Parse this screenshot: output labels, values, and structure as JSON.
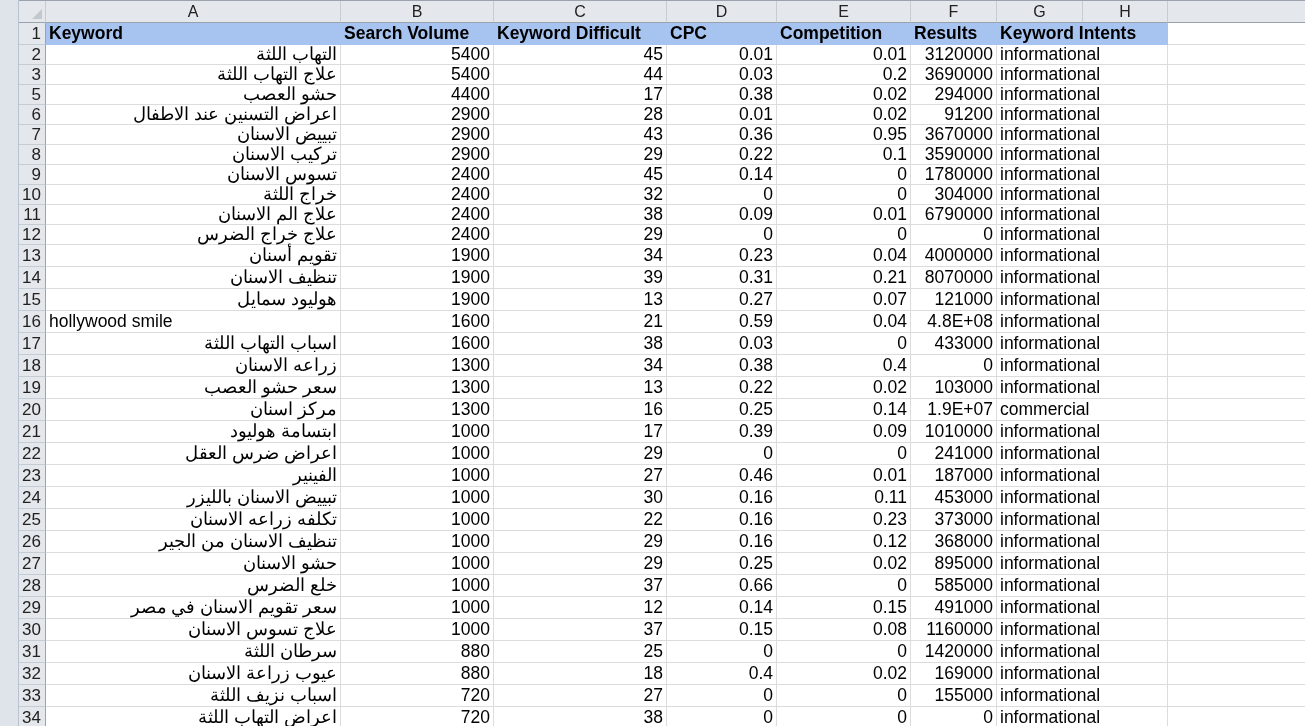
{
  "columns": [
    "A",
    "B",
    "C",
    "D",
    "E",
    "F",
    "G",
    "H"
  ],
  "header": {
    "number": "1",
    "cells": [
      "Keyword",
      "Search Volume",
      "Keyword Difficult",
      "CPC",
      "Competition",
      "Results",
      "Keyword Intents"
    ]
  },
  "rows": [
    {
      "number": "2",
      "cells": [
        "التهاب اللثة",
        "5400",
        "45",
        "0.01",
        "0.01",
        "3120000",
        "informational"
      ]
    },
    {
      "number": "3",
      "cells": [
        "علاج التهاب اللثة",
        "5400",
        "44",
        "0.03",
        "0.2",
        "3690000",
        "informational"
      ]
    },
    {
      "number": "5",
      "cells": [
        "حشو العصب",
        "4400",
        "17",
        "0.38",
        "0.02",
        "294000",
        "informational"
      ]
    },
    {
      "number": "6",
      "cells": [
        "اعراض التسنين عند الاطفال",
        "2900",
        "28",
        "0.01",
        "0.02",
        "91200",
        "informational"
      ]
    },
    {
      "number": "7",
      "cells": [
        "تبييض الاسنان",
        "2900",
        "43",
        "0.36",
        "0.95",
        "3670000",
        "informational"
      ]
    },
    {
      "number": "8",
      "cells": [
        "تركيب الاسنان",
        "2900",
        "29",
        "0.22",
        "0.1",
        "3590000",
        "informational"
      ]
    },
    {
      "number": "9",
      "cells": [
        "تسوس الاسنان",
        "2400",
        "45",
        "0.14",
        "0",
        "1780000",
        "informational"
      ]
    },
    {
      "number": "10",
      "cells": [
        "خراج اللثة",
        "2400",
        "32",
        "0",
        "0",
        "304000",
        "informational"
      ]
    },
    {
      "number": "11",
      "cells": [
        "علاج الم الاسنان",
        "2400",
        "38",
        "0.09",
        "0.01",
        "6790000",
        "informational"
      ]
    },
    {
      "number": "12",
      "cells": [
        "علاج خراج الضرس",
        "2400",
        "29",
        "0",
        "0",
        "0",
        "informational"
      ]
    },
    {
      "number": "13",
      "cells": [
        "تقويم أسنان",
        "1900",
        "34",
        "0.23",
        "0.04",
        "4000000",
        "informational"
      ]
    },
    {
      "number": "14",
      "cells": [
        "تنظيف الاسنان",
        "1900",
        "39",
        "0.31",
        "0.21",
        "8070000",
        "informational"
      ]
    },
    {
      "number": "15",
      "cells": [
        "هوليود سمايل",
        "1900",
        "13",
        "0.27",
        "0.07",
        "121000",
        "informational"
      ]
    },
    {
      "number": "16",
      "cells": [
        "hollywood smile",
        "1600",
        "21",
        "0.59",
        "0.04",
        "4.8E+08",
        "informational"
      ]
    },
    {
      "number": "17",
      "cells": [
        "اسباب التهاب اللثة",
        "1600",
        "38",
        "0.03",
        "0",
        "433000",
        "informational"
      ]
    },
    {
      "number": "18",
      "cells": [
        "زراعه الاسنان",
        "1300",
        "34",
        "0.38",
        "0.4",
        "0",
        "informational"
      ]
    },
    {
      "number": "19",
      "cells": [
        "سعر حشو العصب",
        "1300",
        "13",
        "0.22",
        "0.02",
        "103000",
        "informational"
      ]
    },
    {
      "number": "20",
      "cells": [
        "مركز اسنان",
        "1300",
        "16",
        "0.25",
        "0.14",
        "1.9E+07",
        "commercial"
      ]
    },
    {
      "number": "21",
      "cells": [
        "ابتسامة هوليود",
        "1000",
        "17",
        "0.39",
        "0.09",
        "1010000",
        "informational"
      ]
    },
    {
      "number": "22",
      "cells": [
        "اعراض ضرس العقل",
        "1000",
        "29",
        "0",
        "0",
        "241000",
        "informational"
      ]
    },
    {
      "number": "23",
      "cells": [
        "الفينير",
        "1000",
        "27",
        "0.46",
        "0.01",
        "187000",
        "informational"
      ]
    },
    {
      "number": "24",
      "cells": [
        "تبييض الاسنان بالليزر",
        "1000",
        "30",
        "0.16",
        "0.11",
        "453000",
        "informational"
      ]
    },
    {
      "number": "25",
      "cells": [
        "تكلفه زراعه الاسنان",
        "1000",
        "22",
        "0.16",
        "0.23",
        "373000",
        "informational"
      ]
    },
    {
      "number": "26",
      "cells": [
        "تنظيف الاسنان من الجير",
        "1000",
        "29",
        "0.16",
        "0.12",
        "368000",
        "informational"
      ]
    },
    {
      "number": "27",
      "cells": [
        "حشو الاسنان",
        "1000",
        "29",
        "0.25",
        "0.02",
        "895000",
        "informational"
      ]
    },
    {
      "number": "28",
      "cells": [
        "خلع الضرس",
        "1000",
        "37",
        "0.66",
        "0",
        "585000",
        "informational"
      ]
    },
    {
      "number": "29",
      "cells": [
        "سعر تقويم الاسنان في مصر",
        "1000",
        "12",
        "0.14",
        "0.15",
        "491000",
        "informational"
      ]
    },
    {
      "number": "30",
      "cells": [
        "علاج تسوس الاسنان",
        "1000",
        "37",
        "0.15",
        "0.08",
        "1160000",
        "informational"
      ]
    },
    {
      "number": "31",
      "cells": [
        "سرطان اللثة",
        "880",
        "25",
        "0",
        "0",
        "1420000",
        "informational"
      ]
    },
    {
      "number": "32",
      "cells": [
        "عيوب زراعة الاسنان",
        "880",
        "18",
        "0.4",
        "0.02",
        "169000",
        "informational"
      ]
    },
    {
      "number": "33",
      "cells": [
        "اسباب نزيف اللثة",
        "720",
        "27",
        "0",
        "0",
        "155000",
        "informational"
      ]
    },
    {
      "number": "34",
      "cells": [
        "اعراض التهاب اللثة",
        "720",
        "38",
        "0",
        "0",
        "0",
        "informational"
      ]
    }
  ]
}
